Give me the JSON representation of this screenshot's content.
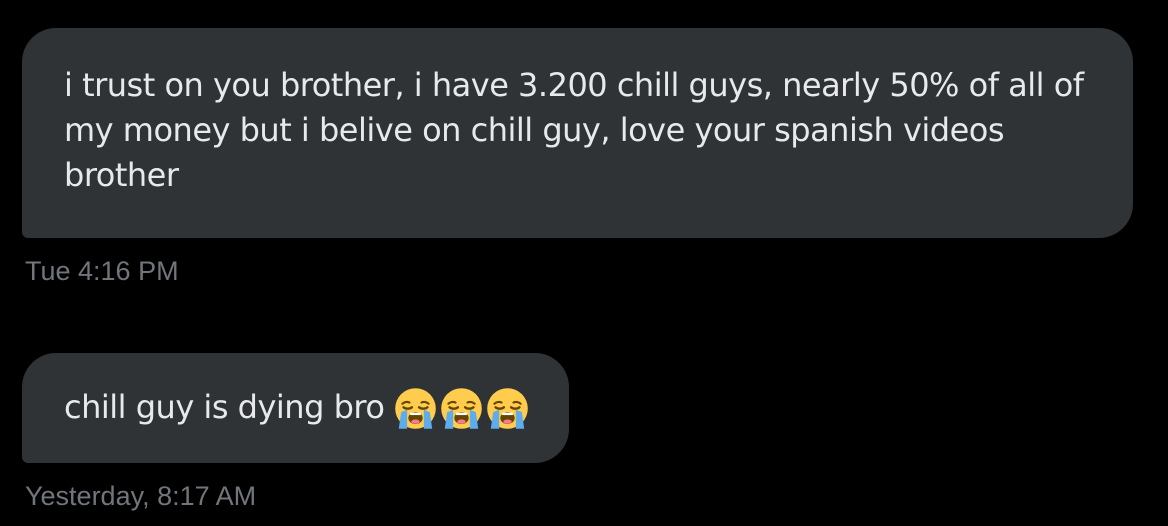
{
  "messages": [
    {
      "text": "i trust on you brother, i have 3.200 chill guys, nearly 50% of all of my money but i belive on chill guy, love your spanish videos brother",
      "timestamp": "Tue 4:16 PM"
    },
    {
      "text": "chill guy is dying bro",
      "emojis": [
        "loudly-crying-face",
        "loudly-crying-face",
        "loudly-crying-face"
      ],
      "timestamp": "Yesterday, 8:17 AM"
    }
  ],
  "colors": {
    "background": "#000000",
    "bubble": "#2f3336",
    "text": "#e7e9ea",
    "timestamp": "#71767b"
  }
}
